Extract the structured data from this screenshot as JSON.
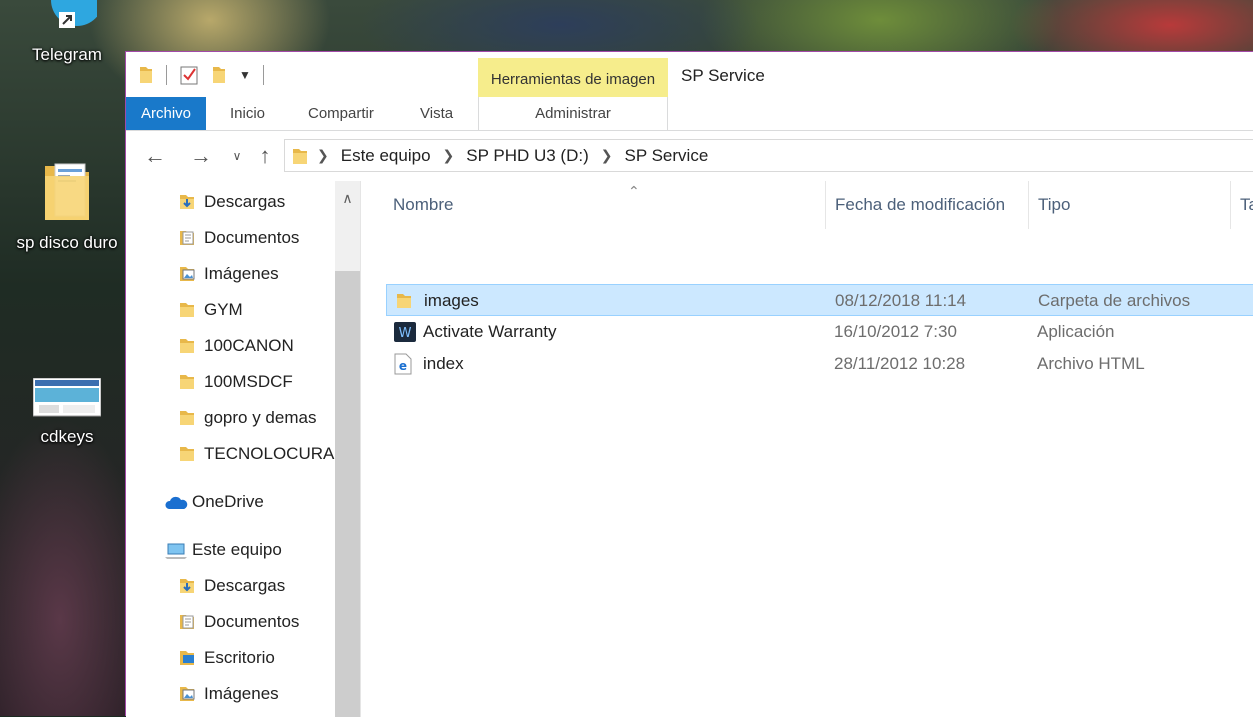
{
  "desktop": {
    "icons": [
      {
        "label": "Telegram",
        "icon": "telegram-icon"
      },
      {
        "label": "sp disco duro",
        "icon": "folder-icon"
      },
      {
        "label": "cdkeys",
        "icon": "image-thumbnail-icon"
      }
    ]
  },
  "window": {
    "title": "SP Service",
    "context_tab_label": "Herramientas de imagen",
    "context_tab_sub": "Administrar",
    "accent": "#1979ca",
    "context_color": "#f6ed8c"
  },
  "ribbon": {
    "tabs": [
      "Archivo",
      "Inicio",
      "Compartir",
      "Vista"
    ]
  },
  "address": {
    "crumbs": [
      "Este equipo",
      "SP PHD U3 (D:)",
      "SP Service"
    ]
  },
  "nav": {
    "quick_access": [
      {
        "label": "Descargas",
        "icon": "download-folder-icon",
        "pinned": true
      },
      {
        "label": "Documentos",
        "icon": "documents-folder-icon",
        "pinned": true
      },
      {
        "label": "Imágenes",
        "icon": "pictures-folder-icon",
        "pinned": true
      },
      {
        "label": "GYM",
        "icon": "folder-icon",
        "pinned": true
      },
      {
        "label": "100CANON",
        "icon": "folder-icon",
        "pinned": false
      },
      {
        "label": "100MSDCF",
        "icon": "folder-icon",
        "pinned": false
      },
      {
        "label": "gopro y demas",
        "icon": "folder-icon",
        "pinned": false
      },
      {
        "label": "TECNOLOCURA",
        "icon": "folder-icon",
        "pinned": false
      }
    ],
    "onedrive": "OneDrive",
    "this_pc": "Este equipo",
    "this_pc_items": [
      {
        "label": "Descargas",
        "icon": "download-folder-icon"
      },
      {
        "label": "Documentos",
        "icon": "documents-folder-icon"
      },
      {
        "label": "Escritorio",
        "icon": "desktop-folder-icon"
      },
      {
        "label": "Imágenes",
        "icon": "pictures-folder-icon"
      }
    ]
  },
  "columns": [
    "Nombre",
    "Fecha de modificación",
    "Tipo",
    "Ta"
  ],
  "files": [
    {
      "name": "images",
      "date": "08/12/2018 11:14",
      "type": "Carpeta de archivos",
      "icon": "folder-icon",
      "selected": true
    },
    {
      "name": "Activate Warranty",
      "date": "16/10/2012 7:30",
      "type": "Aplicación",
      "icon": "application-icon",
      "selected": false
    },
    {
      "name": "index",
      "date": "28/11/2012 10:28",
      "type": "Archivo HTML",
      "icon": "edge-html-icon",
      "selected": false
    }
  ]
}
